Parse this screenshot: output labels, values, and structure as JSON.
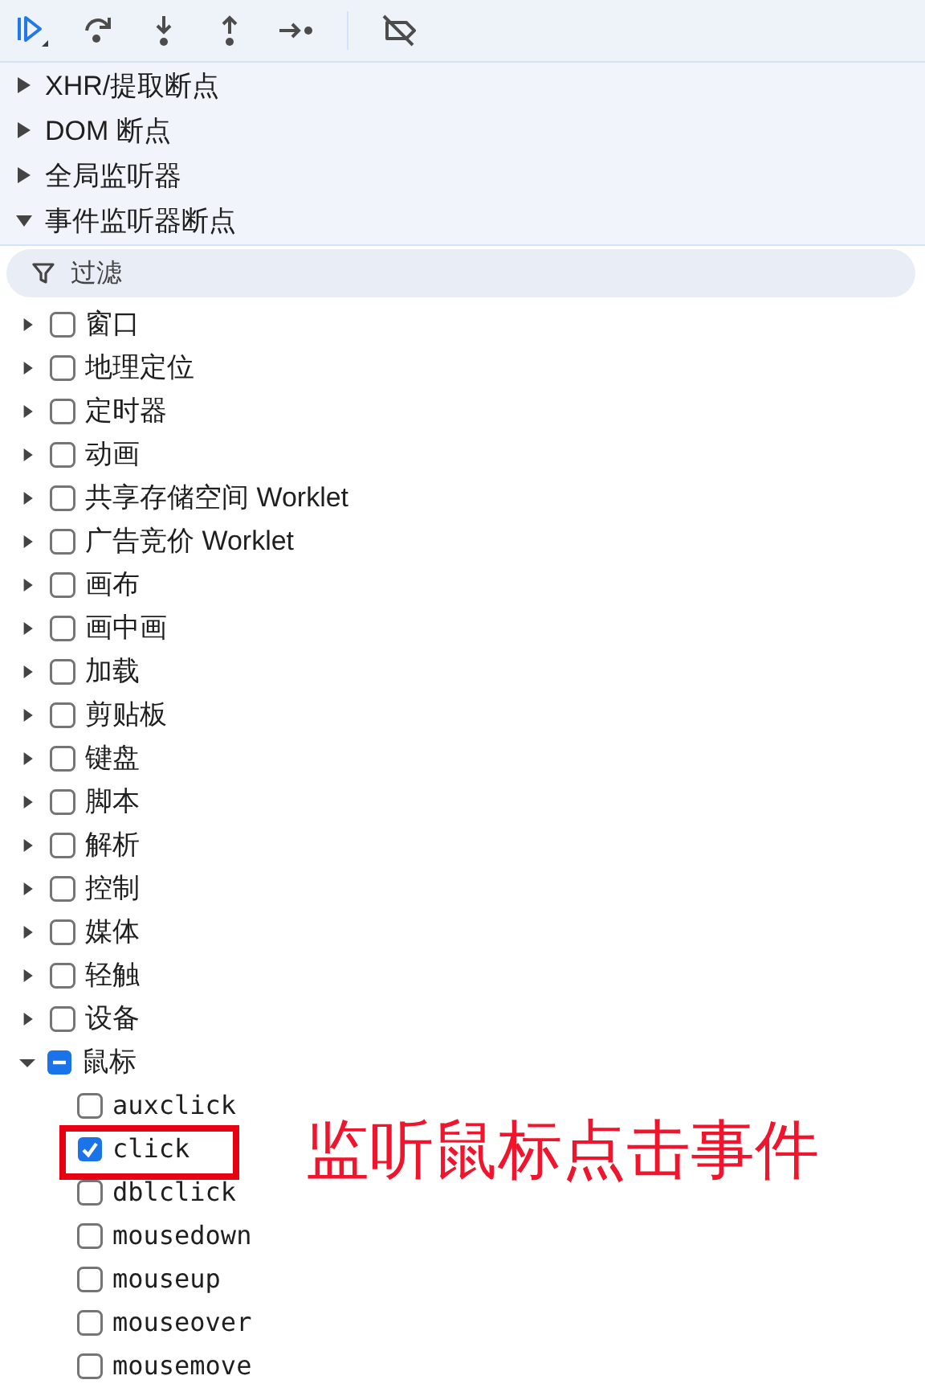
{
  "toolbar": {
    "buttons": [
      {
        "kind": "resume"
      },
      {
        "kind": "step-over"
      },
      {
        "kind": "step-into"
      },
      {
        "kind": "step-out"
      },
      {
        "kind": "step"
      },
      {
        "kind": "separator"
      },
      {
        "kind": "deactivate"
      }
    ]
  },
  "sections": [
    {
      "label": "XHR/提取断点",
      "expanded": false
    },
    {
      "label": "DOM 断点",
      "expanded": false
    },
    {
      "label": "全局监听器",
      "expanded": false
    },
    {
      "label": "事件监听器断点",
      "expanded": true
    }
  ],
  "filter": {
    "placeholder": "过滤"
  },
  "categories": [
    {
      "label": "窗口",
      "checked": false,
      "indeterminate": false,
      "expanded": false
    },
    {
      "label": "地理定位",
      "checked": false,
      "indeterminate": false,
      "expanded": false
    },
    {
      "label": "定时器",
      "checked": false,
      "indeterminate": false,
      "expanded": false
    },
    {
      "label": "动画",
      "checked": false,
      "indeterminate": false,
      "expanded": false
    },
    {
      "label": "共享存储空间 Worklet",
      "checked": false,
      "indeterminate": false,
      "expanded": false
    },
    {
      "label": "广告竞价 Worklet",
      "checked": false,
      "indeterminate": false,
      "expanded": false
    },
    {
      "label": "画布",
      "checked": false,
      "indeterminate": false,
      "expanded": false
    },
    {
      "label": "画中画",
      "checked": false,
      "indeterminate": false,
      "expanded": false
    },
    {
      "label": "加载",
      "checked": false,
      "indeterminate": false,
      "expanded": false
    },
    {
      "label": "剪贴板",
      "checked": false,
      "indeterminate": false,
      "expanded": false
    },
    {
      "label": "键盘",
      "checked": false,
      "indeterminate": false,
      "expanded": false
    },
    {
      "label": "脚本",
      "checked": false,
      "indeterminate": false,
      "expanded": false
    },
    {
      "label": "解析",
      "checked": false,
      "indeterminate": false,
      "expanded": false
    },
    {
      "label": "控制",
      "checked": false,
      "indeterminate": false,
      "expanded": false
    },
    {
      "label": "媒体",
      "checked": false,
      "indeterminate": false,
      "expanded": false
    },
    {
      "label": "轻触",
      "checked": false,
      "indeterminate": false,
      "expanded": false
    },
    {
      "label": "设备",
      "checked": false,
      "indeterminate": false,
      "expanded": false
    },
    {
      "label": "鼠标",
      "checked": false,
      "indeterminate": true,
      "expanded": true,
      "children": [
        {
          "label": "auxclick",
          "checked": false,
          "highlighted": false
        },
        {
          "label": "click",
          "checked": true,
          "highlighted": true
        },
        {
          "label": "dblclick",
          "checked": false,
          "highlighted": false
        },
        {
          "label": "mousedown",
          "checked": false,
          "highlighted": false
        },
        {
          "label": "mouseup",
          "checked": false,
          "highlighted": false
        },
        {
          "label": "mouseover",
          "checked": false,
          "highlighted": false
        },
        {
          "label": "mousemove",
          "checked": false,
          "highlighted": false
        }
      ]
    }
  ],
  "annotation": {
    "text": "监听鼠标点击事件"
  }
}
